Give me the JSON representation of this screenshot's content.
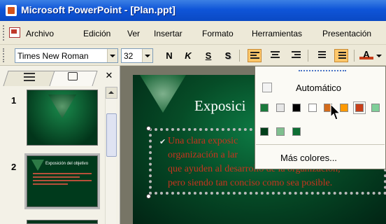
{
  "window": {
    "title": "Microsoft PowerPoint - [Plan.ppt]"
  },
  "menu": [
    "Archivo",
    "Edición",
    "Ver",
    "Insertar",
    "Formato",
    "Herramientas",
    "Presentación"
  ],
  "toolbar": {
    "font_name": "Times New Roman",
    "font_size": "32",
    "bold": "N",
    "italic": "K",
    "underline": "S",
    "shadow": "S",
    "font_color_letter": "A"
  },
  "panel": {
    "close": "✕",
    "slide_numbers": [
      "1",
      "2"
    ],
    "thumb2_title": "Exposición del objetivo"
  },
  "slide": {
    "title": "Exposici",
    "body_lines": [
      "Una clara exposic",
      "organización a lar",
      "que ayuden al desarrollo de la organización,",
      "pero siendo tan conciso como sea posible."
    ]
  },
  "color_menu": {
    "automatic_label": "Automático",
    "more_colors_label": "Más colores...",
    "row1_colors": [
      "#1b7a3c",
      "#e6e6e6",
      "#000000",
      "#ffffff",
      "#d36b1b",
      "#ff9900",
      "#c83f1a",
      "#7fcf99"
    ],
    "row2_colors": [
      "#013f1a",
      "#7fbf8f",
      "#0d6e33"
    ],
    "selected_color": "#c83f1a",
    "accent": "#ffc86b"
  }
}
